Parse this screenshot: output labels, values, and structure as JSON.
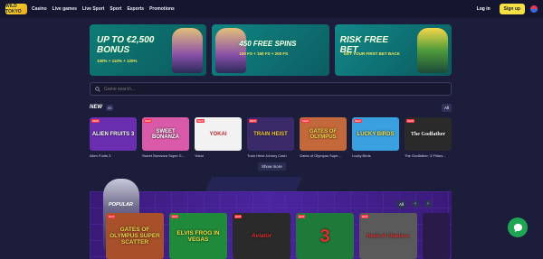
{
  "header": {
    "logo_text": "WILD TOKYO",
    "nav": [
      "Casino",
      "Live games",
      "Live Sport",
      "Sport",
      "Esports",
      "Promotions"
    ],
    "login_label": "Log in",
    "signup_label": "Sign up"
  },
  "banners": [
    {
      "title": "UP TO €2,500 BONUS",
      "subtitle": "100% + 110% + 120%"
    },
    {
      "title": "450 FREE SPINS",
      "subtitle": "100 FS + 150 FS + 200 FS"
    },
    {
      "title": "RISK FREE BET",
      "subtitle": "GET YOUR FIRST BET BACK"
    }
  ],
  "search": {
    "placeholder": "Game search..."
  },
  "new_section": {
    "title": "NEW",
    "count": "65",
    "all_label": "All",
    "games": [
      {
        "name": "Alien Fruits 3",
        "thumb": "ALIEN FRUITS 3",
        "color": "#6a2fb0"
      },
      {
        "name": "Sweet Bonanza Super S...",
        "thumb": "SWEET BONANZA",
        "color": "#d85aa8"
      },
      {
        "name": "Yokai",
        "thumb": "YOKAI",
        "color": "#f2f2f2"
      },
      {
        "name": "Train Heist Johnny Cash",
        "thumb": "TRAIN HEIST",
        "color": "#3a2a6a"
      },
      {
        "name": "Gates of Olympus Supe...",
        "thumb": "GATES OF OLYMPUS",
        "color": "#c2683a"
      },
      {
        "name": "Lucky Birds",
        "thumb": "LUCKY BIRDS",
        "color": "#3aa0e0"
      },
      {
        "name": "The Godfather: 3 Pillars...",
        "thumb": "The Godfather",
        "color": "#2a2a2a"
      }
    ],
    "show_more_label": "Show more"
  },
  "popular_section": {
    "title": "POPULAR",
    "all_label": "All",
    "prev_icon": "‹",
    "next_icon": "›",
    "games": [
      {
        "thumb": "GATES OF OLYMPUS SUPER SCATTER",
        "color": "#a8502a"
      },
      {
        "thumb": "ELVIS FROG IN VEGAS",
        "color": "#1f8a3a"
      },
      {
        "thumb": "Aviator",
        "color": "#2a2a2a"
      },
      {
        "thumb": "3",
        "color": "#1f7a3a"
      },
      {
        "thumb": "Book of Shadows",
        "color": "#5a5a5a"
      },
      {
        "thumb": "",
        "color": "#2a1a4a"
      }
    ]
  },
  "colors": {
    "accent": "#f4e042",
    "background": "#1c1d3b",
    "chat": "#1fa653"
  }
}
